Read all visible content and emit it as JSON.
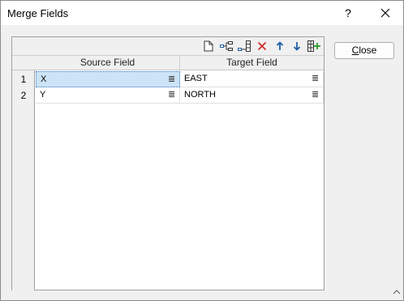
{
  "window": {
    "title": "Merge Fields",
    "help_label": "?",
    "close_glyph": "✕"
  },
  "toolbar": {
    "icons": [
      "new-file-icon",
      "tree-structure-icon",
      "insert-field-icon",
      "delete-icon",
      "move-up-icon",
      "move-down-icon",
      "add-column-icon"
    ]
  },
  "grid": {
    "columns": [
      "Source Field",
      "Target Field"
    ],
    "rows": [
      {
        "num": "1",
        "source": "X",
        "target": "EAST"
      },
      {
        "num": "2",
        "source": "Y",
        "target": "NORTH"
      }
    ],
    "selected_cell": "row 1, Source Field"
  },
  "buttons": {
    "close_first": "C",
    "close_rest": "lose"
  },
  "colors": {
    "selection": "#cce4f7",
    "delete": "#d03030",
    "arrow": "#1f5fa8"
  }
}
